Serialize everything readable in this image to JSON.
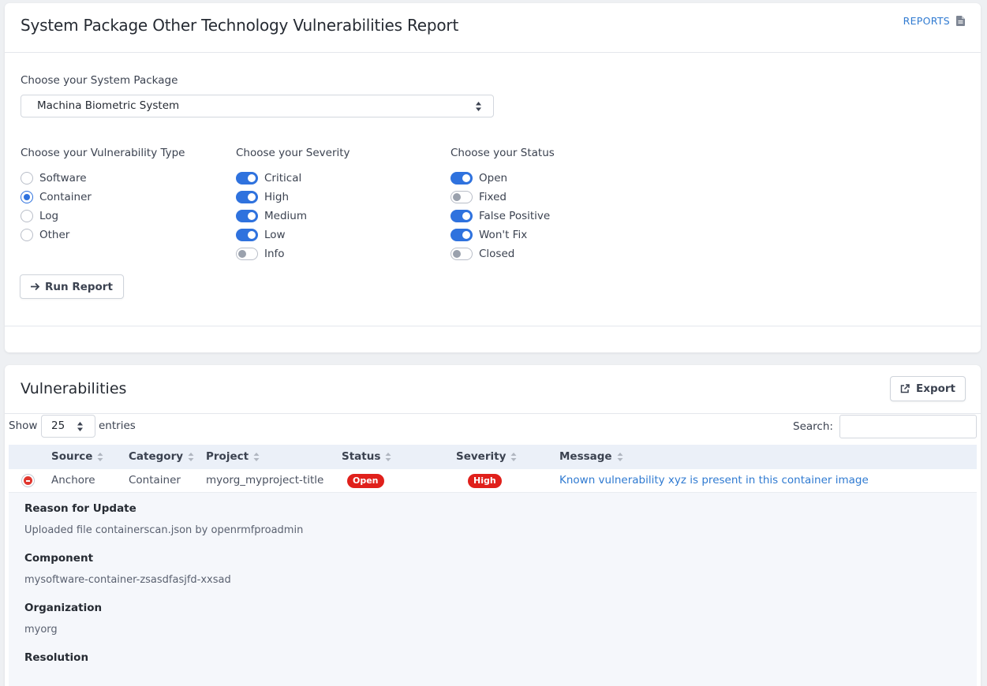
{
  "header": {
    "title": "System Package Other Technology Vulnerabilities Report",
    "reports_link": "REPORTS"
  },
  "package": {
    "label": "Choose your System Package",
    "selected": "Machina Biometric System"
  },
  "vuln_type": {
    "label": "Choose your Vulnerability Type",
    "options": [
      {
        "label": "Software",
        "checked": false
      },
      {
        "label": "Container",
        "checked": true
      },
      {
        "label": "Log",
        "checked": false
      },
      {
        "label": "Other",
        "checked": false
      }
    ]
  },
  "severity": {
    "label": "Choose your Severity",
    "options": [
      {
        "label": "Critical",
        "on": true
      },
      {
        "label": "High",
        "on": true
      },
      {
        "label": "Medium",
        "on": true
      },
      {
        "label": "Low",
        "on": true
      },
      {
        "label": "Info",
        "on": false
      }
    ]
  },
  "status": {
    "label": "Choose your Status",
    "options": [
      {
        "label": "Open",
        "on": true
      },
      {
        "label": "Fixed",
        "on": false
      },
      {
        "label": "False Positive",
        "on": true
      },
      {
        "label": "Won't Fix",
        "on": true
      },
      {
        "label": "Closed",
        "on": false
      }
    ]
  },
  "run_button": "Run Report",
  "vulnerabilities": {
    "title": "Vulnerabilities",
    "export_label": "Export",
    "show_label": "Show",
    "page_length": "25",
    "entries_label": "entries",
    "search_label": "Search:",
    "columns": [
      "Source",
      "Category",
      "Project",
      "Status",
      "Severity",
      "Message"
    ],
    "row": {
      "source": "Anchore",
      "category": "Container",
      "project": "myorg_myproject-title",
      "status": "Open",
      "severity": "High",
      "message": "Known vulnerability xyz is present in this container image"
    },
    "details": [
      {
        "label": "Reason for Update",
        "value": "Uploaded file containerscan.json by openrmfproadmin"
      },
      {
        "label": "Component",
        "value": "mysoftware-container-zsasdfasjfd-xxsad"
      },
      {
        "label": "Organization",
        "value": "myorg"
      },
      {
        "label": "Resolution",
        "value": ""
      }
    ]
  },
  "colors": {
    "accent": "#2f72de",
    "link": "#2f7ad1",
    "danger": "#e0201b"
  }
}
